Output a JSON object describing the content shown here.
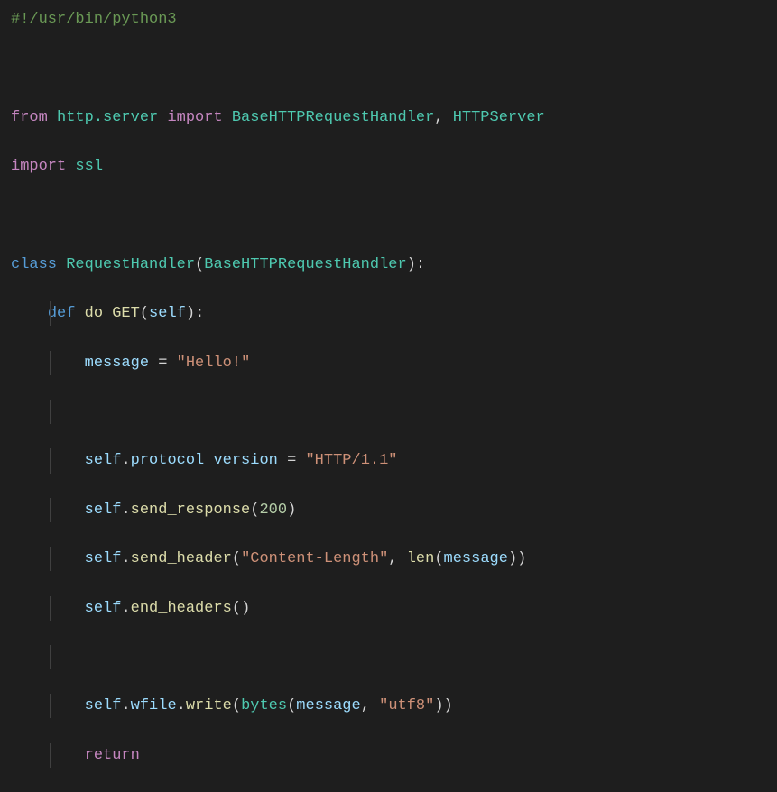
{
  "code": {
    "shebang": "#!/usr/bin/python3",
    "kw_from": "from",
    "mod_http_server": "http.server",
    "kw_import": "import",
    "cls_BaseHTTPRequestHandler": "BaseHTTPRequestHandler",
    "cls_HTTPServer": "HTTPServer",
    "mod_ssl": "ssl",
    "kw_class": "class",
    "cls_RequestHandler": "RequestHandler",
    "kw_def": "def",
    "fn_do_GET": "do_GET",
    "param_self": "self",
    "var_message": "message",
    "str_hello": "\"Hello!\"",
    "self": "self",
    "prop_protocol_version": "protocol_version",
    "str_http11": "\"HTTP/1.1\"",
    "m_send_response": "send_response",
    "num_200": "200",
    "m_send_header": "send_header",
    "str_content_length": "\"Content-Length\"",
    "fn_len": "len",
    "m_end_headers": "end_headers",
    "prop_wfile": "wfile",
    "m_write": "write",
    "fn_bytes": "bytes",
    "str_utf8": "\"utf8\"",
    "kw_return": "return",
    "comma_sp": ", ",
    "eq_sp": " = ",
    "lparen": "(",
    "rparen": ")",
    "colon": ":",
    "dot": "."
  }
}
